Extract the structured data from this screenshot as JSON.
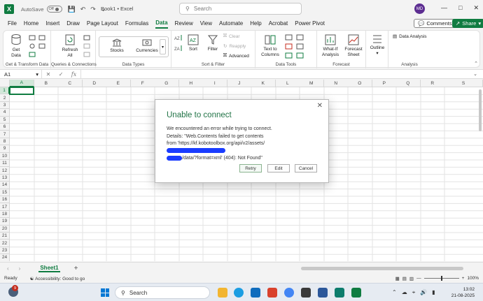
{
  "titlebar": {
    "autosave_label": "AutoSave",
    "autosave_state": "Off",
    "book_title": "Book1 • Excel",
    "search_placeholder": "Search",
    "avatar_initials": "MD"
  },
  "menu": {
    "tabs": [
      "File",
      "Home",
      "Insert",
      "Draw",
      "Page Layout",
      "Formulas",
      "Data",
      "Review",
      "View",
      "Automate",
      "Help",
      "Acrobat",
      "Power Pivot"
    ],
    "active": "Data",
    "comments_label": "Comments",
    "share_label": "Share"
  },
  "ribbon": {
    "get_data": "Get Data",
    "group_get_transform": "Get & Transform Data",
    "refresh_all": "Refresh All",
    "group_queries": "Queries & Connections",
    "stocks": "Stocks",
    "currencies": "Currencies",
    "group_data_types": "Data Types",
    "sort": "Sort",
    "filter": "Filter",
    "clear": "Clear",
    "reapply": "Reapply",
    "advanced": "Advanced",
    "group_sort_filter": "Sort & Filter",
    "text_to_columns": "Text to Columns",
    "group_data_tools": "Data Tools",
    "what_if": "What-If Analysis",
    "forecast_sheet": "Forecast Sheet",
    "group_forecast": "Forecast",
    "outline": "Outline",
    "data_analysis": "Data Analysis",
    "group_analysis": "Analysis"
  },
  "formula_bar": {
    "name_box": "A1",
    "fx": "fx",
    "content": ""
  },
  "grid": {
    "columns": [
      "A",
      "B",
      "C",
      "D",
      "E",
      "F",
      "G",
      "H",
      "I",
      "J",
      "K",
      "L",
      "M",
      "N",
      "O",
      "P",
      "Q",
      "R",
      "S"
    ],
    "rows": [
      "1",
      "2",
      "3",
      "4",
      "5",
      "6",
      "7",
      "8",
      "9",
      "10",
      "11",
      "12",
      "13",
      "14",
      "15",
      "16",
      "17",
      "18",
      "19",
      "20",
      "21",
      "22",
      "23",
      "24"
    ]
  },
  "dialog": {
    "title": "Unable to connect",
    "line1": "We encountered an error while trying to connect.",
    "line2": "Details: \"Web.Contents failed to get contents",
    "line3": "from 'https://kf.kobotoolbox.org/api/v2/assets/",
    "line4": "/data/?format=xml' (404): Not Found\"",
    "retry": "Retry",
    "edit": "Edit",
    "cancel": "Cancel"
  },
  "sheets": {
    "active": "Sheet1"
  },
  "status": {
    "ready": "Ready",
    "accessibility": "Accessibility: Good to go",
    "zoom": "100%"
  },
  "taskbar": {
    "notification_count": "9",
    "search_label": "Search",
    "time": "13:02",
    "date": "21-08-2025"
  },
  "colors": {
    "excel_green": "#107c41",
    "dialog_title": "#217346",
    "redaction": "#1a3cff"
  }
}
